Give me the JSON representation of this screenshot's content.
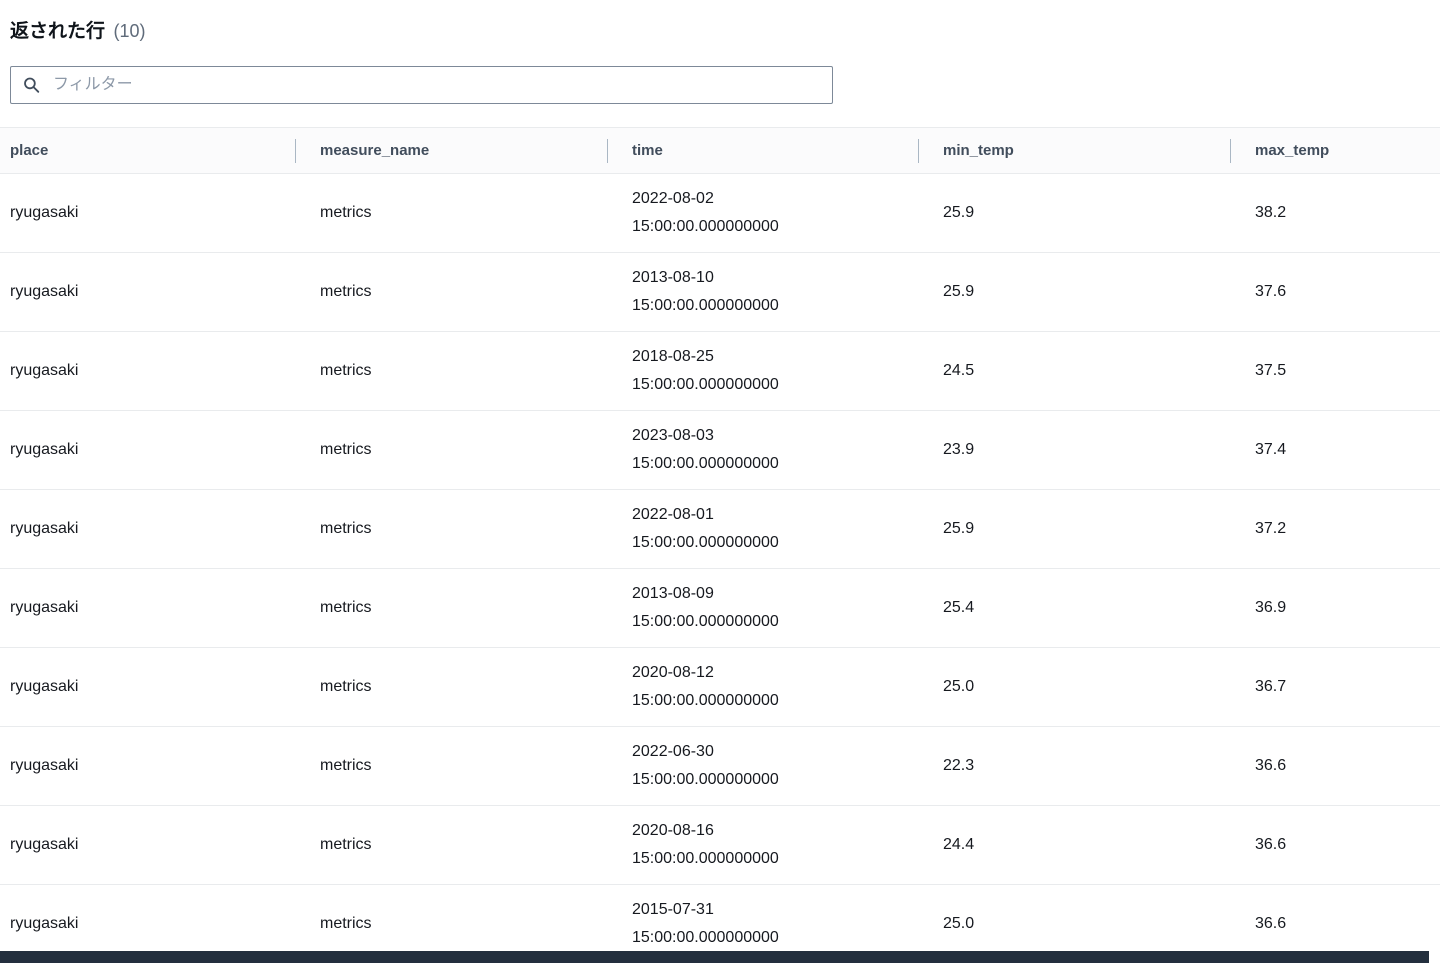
{
  "header": {
    "title": "返された行",
    "count": "(10)"
  },
  "filter": {
    "placeholder": "フィルター",
    "icon": "search-magnifier"
  },
  "table": {
    "columns": [
      {
        "key": "place",
        "label": "place"
      },
      {
        "key": "measure_name",
        "label": "measure_name"
      },
      {
        "key": "time",
        "label": "time"
      },
      {
        "key": "min_temp",
        "label": "min_temp"
      },
      {
        "key": "max_temp",
        "label": "max_temp"
      }
    ],
    "rows": [
      {
        "place": "ryugasaki",
        "measure_name": "metrics",
        "time_date": "2022-08-02",
        "time_clock": "15:00:00.000000000",
        "min_temp": "25.9",
        "max_temp": "38.2"
      },
      {
        "place": "ryugasaki",
        "measure_name": "metrics",
        "time_date": "2013-08-10",
        "time_clock": "15:00:00.000000000",
        "min_temp": "25.9",
        "max_temp": "37.6"
      },
      {
        "place": "ryugasaki",
        "measure_name": "metrics",
        "time_date": "2018-08-25",
        "time_clock": "15:00:00.000000000",
        "min_temp": "24.5",
        "max_temp": "37.5"
      },
      {
        "place": "ryugasaki",
        "measure_name": "metrics",
        "time_date": "2023-08-03",
        "time_clock": "15:00:00.000000000",
        "min_temp": "23.9",
        "max_temp": "37.4"
      },
      {
        "place": "ryugasaki",
        "measure_name": "metrics",
        "time_date": "2022-08-01",
        "time_clock": "15:00:00.000000000",
        "min_temp": "25.9",
        "max_temp": "37.2"
      },
      {
        "place": "ryugasaki",
        "measure_name": "metrics",
        "time_date": "2013-08-09",
        "time_clock": "15:00:00.000000000",
        "min_temp": "25.4",
        "max_temp": "36.9"
      },
      {
        "place": "ryugasaki",
        "measure_name": "metrics",
        "time_date": "2020-08-12",
        "time_clock": "15:00:00.000000000",
        "min_temp": "25.0",
        "max_temp": "36.7"
      },
      {
        "place": "ryugasaki",
        "measure_name": "metrics",
        "time_date": "2022-06-30",
        "time_clock": "15:00:00.000000000",
        "min_temp": "22.3",
        "max_temp": "36.6"
      },
      {
        "place": "ryugasaki",
        "measure_name": "metrics",
        "time_date": "2020-08-16",
        "time_clock": "15:00:00.000000000",
        "min_temp": "24.4",
        "max_temp": "36.6"
      },
      {
        "place": "ryugasaki",
        "measure_name": "metrics",
        "time_date": "2015-07-31",
        "time_clock": "15:00:00.000000000",
        "min_temp": "25.0",
        "max_temp": "36.6"
      }
    ]
  },
  "colors": {
    "bottom_bar": "#232f3e",
    "header_text": "#414d5c",
    "row_border": "#e9ebed",
    "input_border": "#7d8998"
  }
}
